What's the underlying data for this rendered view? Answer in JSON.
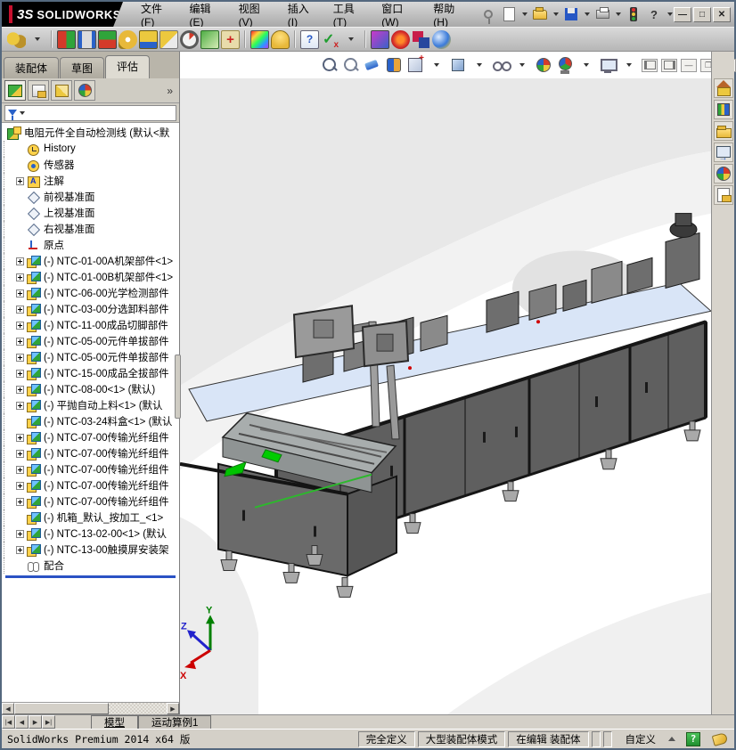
{
  "titlebar": {
    "logo_mark": "3S",
    "logo_text": "SOLIDWORKS",
    "menus": [
      {
        "label": "文件(F)"
      },
      {
        "label": "编辑(E)"
      },
      {
        "label": "视图(V)"
      },
      {
        "label": "插入(I)"
      },
      {
        "label": "工具(T)"
      },
      {
        "label": "窗口(W)"
      },
      {
        "label": "帮助(H)"
      }
    ],
    "window_buttons": [
      {
        "name": "minimize-button",
        "glyph": "—"
      },
      {
        "name": "maximize-button",
        "glyph": "□"
      },
      {
        "name": "close-button",
        "glyph": "✕"
      }
    ]
  },
  "toolbar": {
    "icons": [
      {
        "name": "smart-fasteners-icon",
        "cls": "tb-keys"
      },
      {
        "name": "dropdown-arrow-icon",
        "cls": "dd"
      },
      {
        "name": "separator",
        "cls": "sep",
        "noact": true
      },
      {
        "name": "interference-detection-icon",
        "cls": "tb-interf"
      },
      {
        "name": "clearance-verification-icon",
        "cls": "tb-clear"
      },
      {
        "name": "hole-alignment-icon",
        "cls": "tb-hole"
      },
      {
        "name": "measure-icon",
        "cls": "tb-measure"
      },
      {
        "name": "mass-properties-icon",
        "cls": "tb-mass"
      },
      {
        "name": "section-properties-icon",
        "cls": "tb-section"
      },
      {
        "name": "performance-evaluation-icon",
        "cls": "tb-perf"
      },
      {
        "name": "assembly-visualization-icon",
        "cls": "tb-asmviz"
      },
      {
        "name": "simulationxpress-icon",
        "cls": "tb-simx"
      },
      {
        "name": "separator",
        "cls": "sep",
        "noact": true
      },
      {
        "name": "curvature-icon",
        "cls": "tb-curv"
      },
      {
        "name": "check-document-icon",
        "cls": "tb-bell"
      },
      {
        "name": "separator",
        "cls": "sep",
        "noact": true
      },
      {
        "name": "compare-documents-icon",
        "cls": "tb-compare"
      },
      {
        "name": "verification-check-icon",
        "cls": "tb-verify"
      },
      {
        "name": "dropdown-arrow-icon",
        "cls": "dd"
      },
      {
        "name": "separator",
        "cls": "sep",
        "noact": true
      },
      {
        "name": "appearance-brush-icon",
        "cls": "tb-brush"
      },
      {
        "name": "red-radial-icon",
        "cls": "tb-radial"
      },
      {
        "name": "compare-squares-icon",
        "cls": "tb-squares"
      },
      {
        "name": "color-sphere-icon",
        "cls": "tb-sphere"
      }
    ]
  },
  "command_tabs": [
    {
      "label": "装配体",
      "active": false
    },
    {
      "label": "草图",
      "active": false
    },
    {
      "label": "评估",
      "active": true
    }
  ],
  "manager_tabs": {
    "overflow": "»",
    "icons": [
      {
        "name": "feature-manager-tab-icon",
        "cls": "m-fm",
        "active": true
      },
      {
        "name": "property-manager-tab-icon",
        "cls": "m-pm",
        "active": false
      },
      {
        "name": "configuration-manager-tab-icon",
        "cls": "m-cm",
        "active": false
      },
      {
        "name": "display-manager-tab-icon",
        "cls": "m-dm",
        "active": false
      }
    ]
  },
  "tree": {
    "root_label": "电阻元件全自动检测线  (默认<默",
    "items": [
      {
        "plus": false,
        "icon": "history",
        "label": "History"
      },
      {
        "plus": false,
        "icon": "sensors",
        "label": "传感器"
      },
      {
        "plus": true,
        "icon": "annotations",
        "label": "注解"
      },
      {
        "plus": false,
        "icon": "plane",
        "label": "前视基准面"
      },
      {
        "plus": false,
        "icon": "plane",
        "label": "上视基准面"
      },
      {
        "plus": false,
        "icon": "plane",
        "label": "右视基准面"
      },
      {
        "plus": false,
        "icon": "origin",
        "label": "原点"
      },
      {
        "plus": true,
        "icon": "component",
        "label": "(-) NTC-01-00A机架部件<1>"
      },
      {
        "plus": true,
        "icon": "component",
        "label": "(-) NTC-01-00B机架部件<1>"
      },
      {
        "plus": true,
        "icon": "component",
        "label": "(-) NTC-06-00光学检测部件"
      },
      {
        "plus": true,
        "icon": "component",
        "label": "(-) NTC-03-00分选卸料部件"
      },
      {
        "plus": true,
        "icon": "component",
        "label": "(-) NTC-11-00成品切脚部件"
      },
      {
        "plus": true,
        "icon": "component",
        "label": "(-) NTC-05-00元件单拔部件"
      },
      {
        "plus": true,
        "icon": "component",
        "label": "(-) NTC-05-00元件单拔部件"
      },
      {
        "plus": true,
        "icon": "component",
        "label": "(-) NTC-15-00成品全拔部件"
      },
      {
        "plus": true,
        "icon": "component",
        "label": "(-) NTC-08-00<1>  (默认)"
      },
      {
        "plus": true,
        "icon": "component",
        "label": "(-) 平抛自动上料<1>  (默认"
      },
      {
        "plus": false,
        "icon": "component",
        "label": "(-) NTC-03-24料盒<1>  (默认"
      },
      {
        "plus": true,
        "icon": "component",
        "label": "(-) NTC-07-00传输光纤组件"
      },
      {
        "plus": true,
        "icon": "component",
        "label": "(-) NTC-07-00传输光纤组件"
      },
      {
        "plus": true,
        "icon": "component",
        "label": "(-) NTC-07-00传输光纤组件"
      },
      {
        "plus": true,
        "icon": "component",
        "label": "(-) NTC-07-00传输光纤组件"
      },
      {
        "plus": true,
        "icon": "component",
        "label": "(-) NTC-07-00传输光纤组件"
      },
      {
        "plus": false,
        "icon": "component",
        "label": "(-) 机箱_默认_按加工_<1>"
      },
      {
        "plus": true,
        "icon": "component",
        "label": "(-) NTC-13-02-00<1>  (默认"
      },
      {
        "plus": true,
        "icon": "component",
        "label": "(-) NTC-13-00触摸屏安装架"
      },
      {
        "plus": false,
        "icon": "mates",
        "label": "配合"
      }
    ]
  },
  "hud": {
    "icons": [
      {
        "name": "zoom-to-fit-icon",
        "cls": "hud-zoomfit"
      },
      {
        "name": "zoom-to-area-icon",
        "cls": "hud-zoomarea"
      },
      {
        "name": "previous-view-icon",
        "cls": "hud-prev"
      },
      {
        "name": "section-view-icon",
        "cls": "hud-section"
      },
      {
        "name": "view-orientation-icon",
        "cls": "hud-orient"
      },
      {
        "name": "dropdown-arrow-icon",
        "cls": "dd"
      },
      {
        "name": "display-style-icon",
        "cls": "hud-display"
      },
      {
        "name": "dropdown-arrow-icon",
        "cls": "dd"
      },
      {
        "name": "hide-show-items-icon",
        "cls": "hud-glasses"
      },
      {
        "name": "dropdown-arrow-icon",
        "cls": "dd"
      },
      {
        "name": "edit-appearance-icon",
        "cls": "hud-appearance"
      },
      {
        "name": "apply-scene-icon",
        "cls": "hud-scene"
      },
      {
        "name": "dropdown-arrow-icon",
        "cls": "dd"
      },
      {
        "name": "view-settings-icon",
        "cls": "hud-settings"
      },
      {
        "name": "dropdown-arrow-icon",
        "cls": "dd"
      }
    ]
  },
  "taskpane": {
    "icons": [
      {
        "name": "solidworks-resources-icon",
        "cls": "tp-home"
      },
      {
        "name": "design-library-icon",
        "cls": "tp-lib"
      },
      {
        "name": "file-explorer-icon",
        "cls": "tp-folder"
      },
      {
        "name": "view-palette-icon",
        "cls": "tp-palette"
      },
      {
        "name": "appearances-scenes-icon",
        "cls": "tp-ball"
      },
      {
        "name": "custom-properties-icon",
        "cls": "tp-props"
      }
    ]
  },
  "viewport": {
    "triad": {
      "x": "X",
      "y": "Y",
      "z": "Z"
    },
    "colors": {
      "table_top": "#d9e5f7",
      "cabinet_front": "#5f5f5f",
      "cabinet_left": "#6a6a6a",
      "frame": "#161616",
      "accent_green": "#00cc00",
      "feeder": "#a8adad"
    }
  },
  "model_tabs": {
    "tabs": [
      {
        "label": "模型",
        "active": true
      },
      {
        "label": "运动算例1",
        "active": false
      }
    ]
  },
  "statusbar": {
    "left_text": "SolidWorks Premium 2014 x64 版",
    "segments": [
      "完全定义",
      "大型装配体模式",
      "在编辑  装配体"
    ],
    "custom_label": "自定义"
  }
}
